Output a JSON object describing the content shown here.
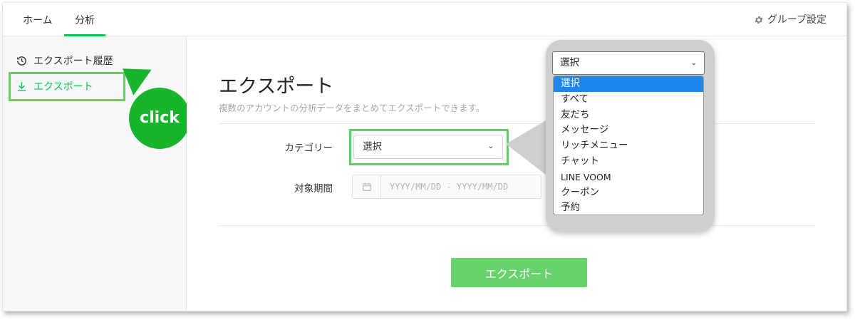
{
  "topnav": {
    "tabs": [
      {
        "label": "ホーム",
        "active": false
      },
      {
        "label": "分析",
        "active": true
      }
    ],
    "group_settings_label": "グループ設定",
    "accent": "#06c755"
  },
  "sidebar": {
    "items": [
      {
        "label": "エクスポート履歴",
        "icon": "history-icon"
      },
      {
        "label": "エクスポート",
        "icon": "download-icon",
        "active": true
      }
    ]
  },
  "annotation": {
    "click_label": "click",
    "highlight_color": "#5fd35f",
    "bubble_color": "#17b52b"
  },
  "main": {
    "title": "エクスポート",
    "subtitle": "複数のアカウントの分析データをまとめてエクスポートできます。",
    "category_label": "カテゴリー",
    "category_value": "選択",
    "period_label": "対象期間",
    "period_placeholder": "YYYY/MM/DD - YYYY/MM/DD",
    "export_button": "エクスポート"
  },
  "callout": {
    "select_value": "選択",
    "options": [
      "選択",
      "すべて",
      "友だち",
      "メッセージ",
      "リッチメニュー",
      "チャット",
      "LINE VOOM",
      "クーポン",
      "予約"
    ],
    "selected_index": 0,
    "selected_color": "#1f86f0"
  }
}
